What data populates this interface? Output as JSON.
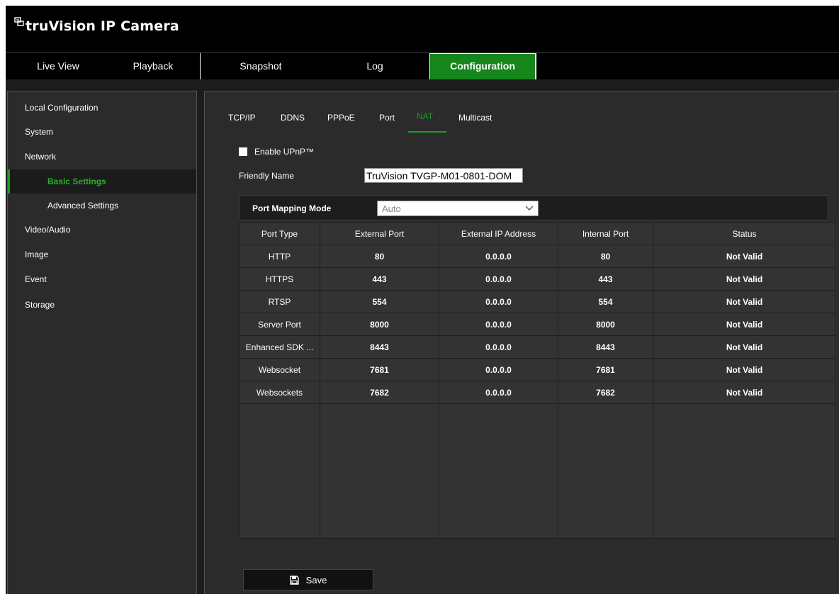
{
  "app": {
    "title": "truVision IP Camera"
  },
  "nav": {
    "tabs": [
      {
        "label": "Live View"
      },
      {
        "label": "Playback"
      },
      {
        "label": "Snapshot"
      },
      {
        "label": "Log"
      },
      {
        "label": "Configuration",
        "active": true
      }
    ]
  },
  "sidebar": {
    "items": [
      {
        "label": "Local Configuration"
      },
      {
        "label": "System"
      },
      {
        "label": "Network"
      },
      {
        "label": "Basic Settings",
        "active": true
      },
      {
        "label": "Advanced Settings"
      },
      {
        "label": "Video/Audio"
      },
      {
        "label": "Image"
      },
      {
        "label": "Event"
      },
      {
        "label": "Storage"
      }
    ]
  },
  "subtabs": [
    {
      "label": "TCP/IP"
    },
    {
      "label": "DDNS"
    },
    {
      "label": "PPPoE"
    },
    {
      "label": "Port"
    },
    {
      "label": "NAT",
      "active": true
    },
    {
      "label": "Multicast"
    }
  ],
  "form": {
    "enable_upnp_label": "Enable UPnP™",
    "enable_upnp_checked": false,
    "friendly_name_label": "Friendly Name",
    "friendly_name_value": "TruVision TVGP-M01-0801-DOM",
    "port_mapping_label": "Port Mapping Mode",
    "port_mapping_value": "Auto"
  },
  "table": {
    "headers": [
      "Port Type",
      "External Port",
      "External IP Address",
      "Internal Port",
      "Status"
    ],
    "rows": [
      [
        "HTTP",
        "80",
        "0.0.0.0",
        "80",
        "Not Valid"
      ],
      [
        "HTTPS",
        "443",
        "0.0.0.0",
        "443",
        "Not Valid"
      ],
      [
        "RTSP",
        "554",
        "0.0.0.0",
        "554",
        "Not Valid"
      ],
      [
        "Server Port",
        "8000",
        "0.0.0.0",
        "8000",
        "Not Valid"
      ],
      [
        "Enhanced SDK ...",
        "8443",
        "0.0.0.0",
        "8443",
        "Not Valid"
      ],
      [
        "Websocket",
        "7681",
        "0.0.0.0",
        "7681",
        "Not Valid"
      ],
      [
        "Websockets",
        "7682",
        "0.0.0.0",
        "7682",
        "Not Valid"
      ]
    ]
  },
  "actions": {
    "save_label": "Save"
  },
  "icons": {
    "logo": "camera-logo-icon",
    "save": "floppy-disk-icon",
    "dropdown": "chevron-down-icon"
  },
  "colors": {
    "accent": "#15861c",
    "active_text": "#17a020",
    "background": "#2b2b2b",
    "header": "#000000"
  }
}
